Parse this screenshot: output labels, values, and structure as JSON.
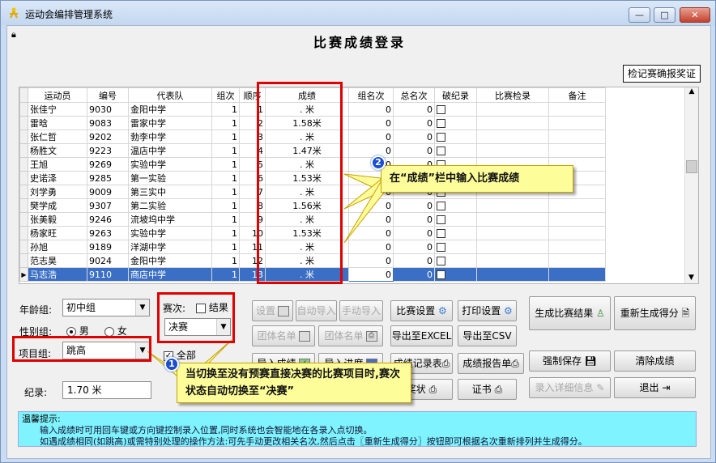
{
  "window": {
    "title": "运动会编排管理系统",
    "min": "—",
    "max": "□",
    "close": "✕"
  },
  "heading": "比赛成绩登录",
  "confirm_button": "检记赛确报奖证",
  "table": {
    "headers": [
      "运动员",
      "编号",
      "代表队",
      "组次",
      "顺序",
      "成绩",
      "组名次",
      "总名次",
      "破纪录",
      "比赛检录",
      "备注"
    ],
    "rows": [
      [
        "张佳宁",
        "9030",
        "金阳中学",
        "1",
        "1",
        ".   米",
        "0",
        "0"
      ],
      [
        "雷晗",
        "9083",
        "雷家中学",
        "1",
        "2",
        "1.58米",
        "0",
        "0"
      ],
      [
        "张仁哲",
        "9202",
        "勃李中学",
        "1",
        "3",
        ".   米",
        "0",
        "0"
      ],
      [
        "杨胜文",
        "9223",
        "温店中学",
        "1",
        "4",
        "1.47米",
        "0",
        "0"
      ],
      [
        "王旭",
        "9269",
        "实验中学",
        "1",
        "5",
        ".   米",
        "0",
        "0"
      ],
      [
        "史诺泽",
        "9285",
        "第一实验",
        "1",
        "6",
        "1.53米",
        "0",
        "0"
      ],
      [
        "刘学勇",
        "9009",
        "第三实中",
        "1",
        "7",
        ".   米",
        "0",
        "0"
      ],
      [
        "樊学成",
        "9307",
        "第二实验",
        "1",
        "8",
        "1.56米",
        "0",
        "0"
      ],
      [
        "张美毅",
        "9246",
        "流坡坞中学",
        "1",
        "9",
        ".   米",
        "0",
        "0"
      ],
      [
        "杨家旺",
        "9263",
        "实验中学",
        "1",
        "10",
        "1.53米",
        "0",
        "0"
      ],
      [
        "孙旭",
        "9189",
        "洋湖中学",
        "1",
        "11",
        ".   米",
        "0",
        "0"
      ],
      [
        "范志昊",
        "9024",
        "金阳中学",
        "1",
        "12",
        ".   米",
        "0",
        "0"
      ],
      [
        "马志浩",
        "9110",
        "商店中学",
        "1",
        "13",
        ".   米",
        "0",
        "0"
      ]
    ]
  },
  "form": {
    "age_group_label": "年龄组:",
    "age_group_value": "初中组",
    "gender_label": "性别组:",
    "male": "男",
    "female": "女",
    "event_label": "项目组:",
    "event_value": "跳高",
    "record_label": "纪录:",
    "record_value": "1.70 米",
    "round_label": "赛次:",
    "result_label": "结果",
    "round_value": "决赛",
    "all_label": "全部"
  },
  "buttons": {
    "settings": "设置",
    "auto_import": "自动导入",
    "manual_import": "手动导入",
    "team_list": "团体名单",
    "team_list2": "团体名单",
    "import_results": "导入成绩",
    "import_progress": "导入进度",
    "match_settings": "比赛设置",
    "print_settings": "打印设置",
    "export_excel": "导出至EXCEL",
    "export_csv": "导出至CSV",
    "record_table": "成绩记录表",
    "report_sheet": "成绩报告单",
    "award": "奖状",
    "certificate": "证书",
    "generate_result": "生成比赛结果",
    "regen_score": "重新生成得分",
    "force_save": "强制保存",
    "clear_results": "清除成绩",
    "enter_details": "录入详细信息",
    "exit": "退出"
  },
  "tips": {
    "title": "温馨提示:",
    "line1": "输入成绩时可用回车键或方向键控制录入位置,同时系统也会智能地在各录入点切换。",
    "line2": "如遇成绩相同(如跳高)或需特别处理的操作方法:可先手动更改相关名次,然后点击〖重新生成得分〗按钮即可根据名次重新排列并生成得分。"
  },
  "callouts": {
    "c1_num": "1",
    "c1_text": "当切换至没有预赛直接决赛的比赛项目时,赛次状态自动切换至“决赛”",
    "c2_num": "2",
    "c2_text": "在“成绩”栏中输入比赛成绩"
  },
  "colors": {
    "title_bg": "#c9dcf3",
    "selected_row": "#3a6fc5",
    "tips_bg": "#7ff3ff",
    "annotation_red": "#e00000",
    "callout_bg": "#fdfd9a"
  }
}
